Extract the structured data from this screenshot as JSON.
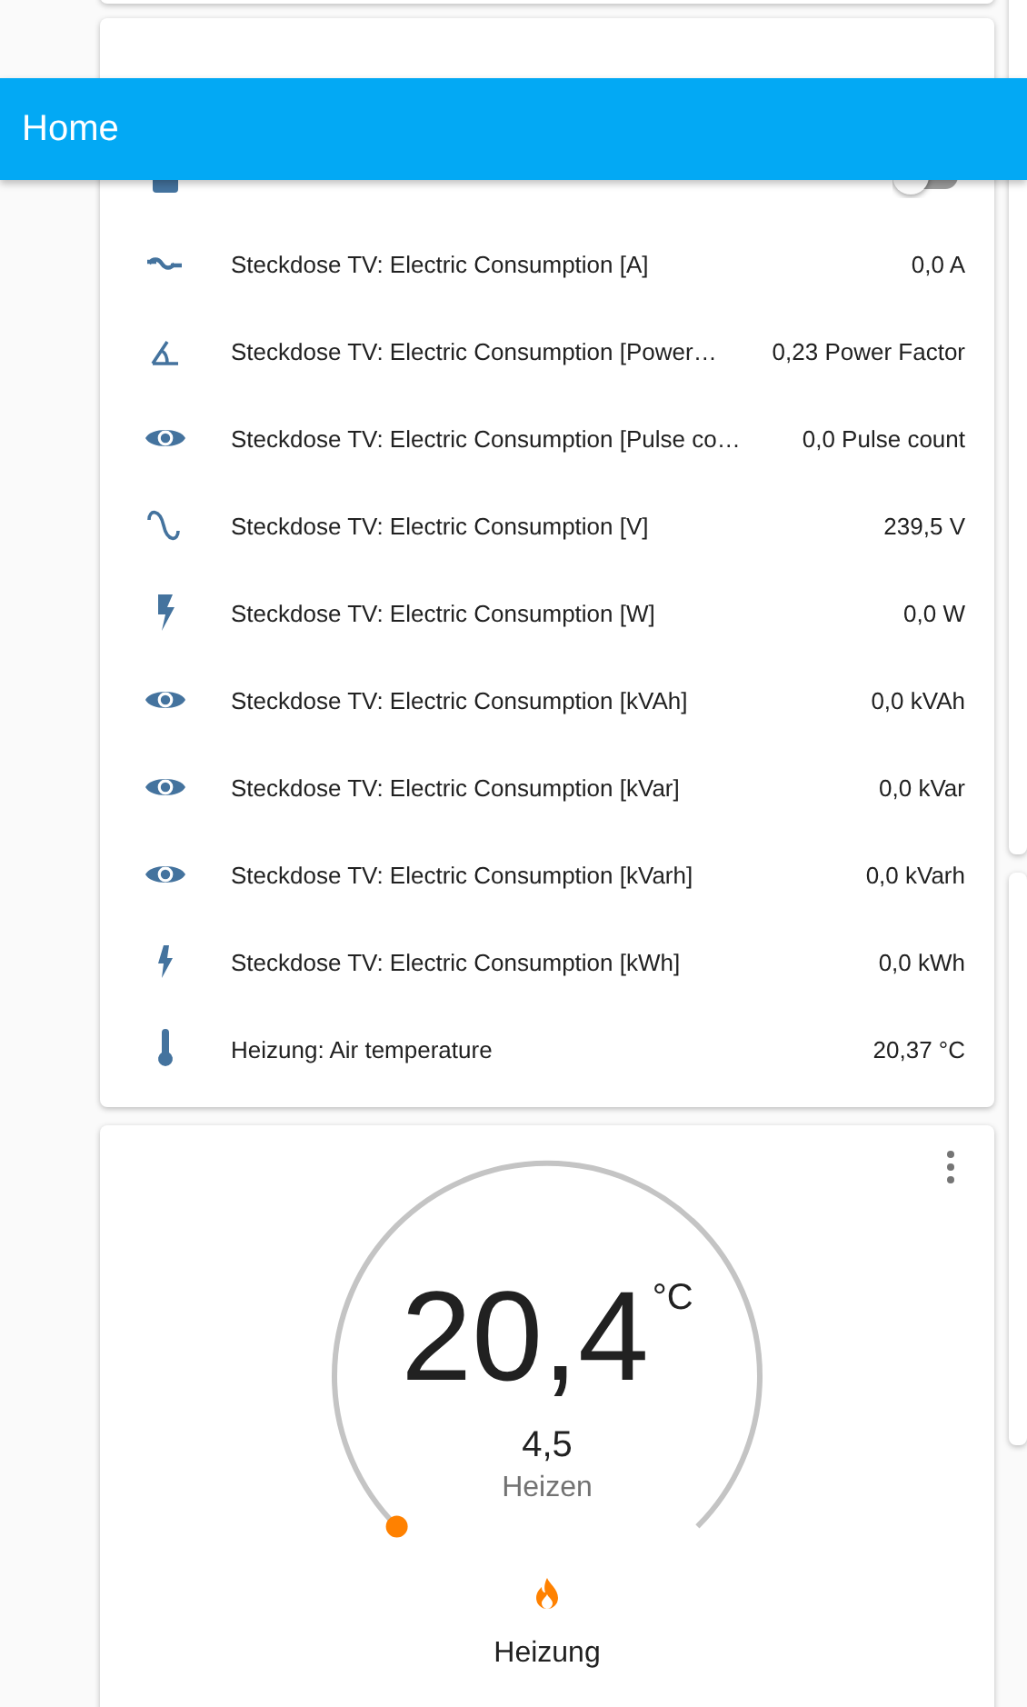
{
  "header": {
    "title": "Home"
  },
  "entities_card": {
    "rows": [
      {
        "kind": "switch",
        "on": false
      },
      {
        "kind": "sensor",
        "name": "Steckdose TV: Electric Consumption [A]",
        "value": "0,0 A"
      },
      {
        "kind": "sensor",
        "name": "Steckdose TV: Electric Consumption [Power…",
        "value": "0,23 Power Factor"
      },
      {
        "kind": "sensor",
        "name": "Steckdose TV: Electric Consumption [Pulse co…",
        "value": "0,0 Pulse count"
      },
      {
        "kind": "sensor",
        "name": "Steckdose TV: Electric Consumption [V]",
        "value": "239,5 V"
      },
      {
        "kind": "sensor",
        "name": "Steckdose TV: Electric Consumption [W]",
        "value": "0,0 W"
      },
      {
        "kind": "sensor",
        "name": "Steckdose TV: Electric Consumption [kVAh]",
        "value": "0,0 kVAh"
      },
      {
        "kind": "sensor",
        "name": "Steckdose TV: Electric Consumption [kVar]",
        "value": "0,0 kVar"
      },
      {
        "kind": "sensor",
        "name": "Steckdose TV: Electric Consumption [kVarh]",
        "value": "0,0 kVarh"
      },
      {
        "kind": "sensor",
        "name": "Steckdose TV: Electric Consumption [kWh]",
        "value": "0,0 kWh"
      },
      {
        "kind": "sensor",
        "name": "Heizung: Air temperature",
        "value": "20,37 °C"
      }
    ]
  },
  "thermostat": {
    "temperature": "20,4",
    "unit": "°C",
    "target": "4,5",
    "mode": "Heizen",
    "name": "Heizung"
  }
}
